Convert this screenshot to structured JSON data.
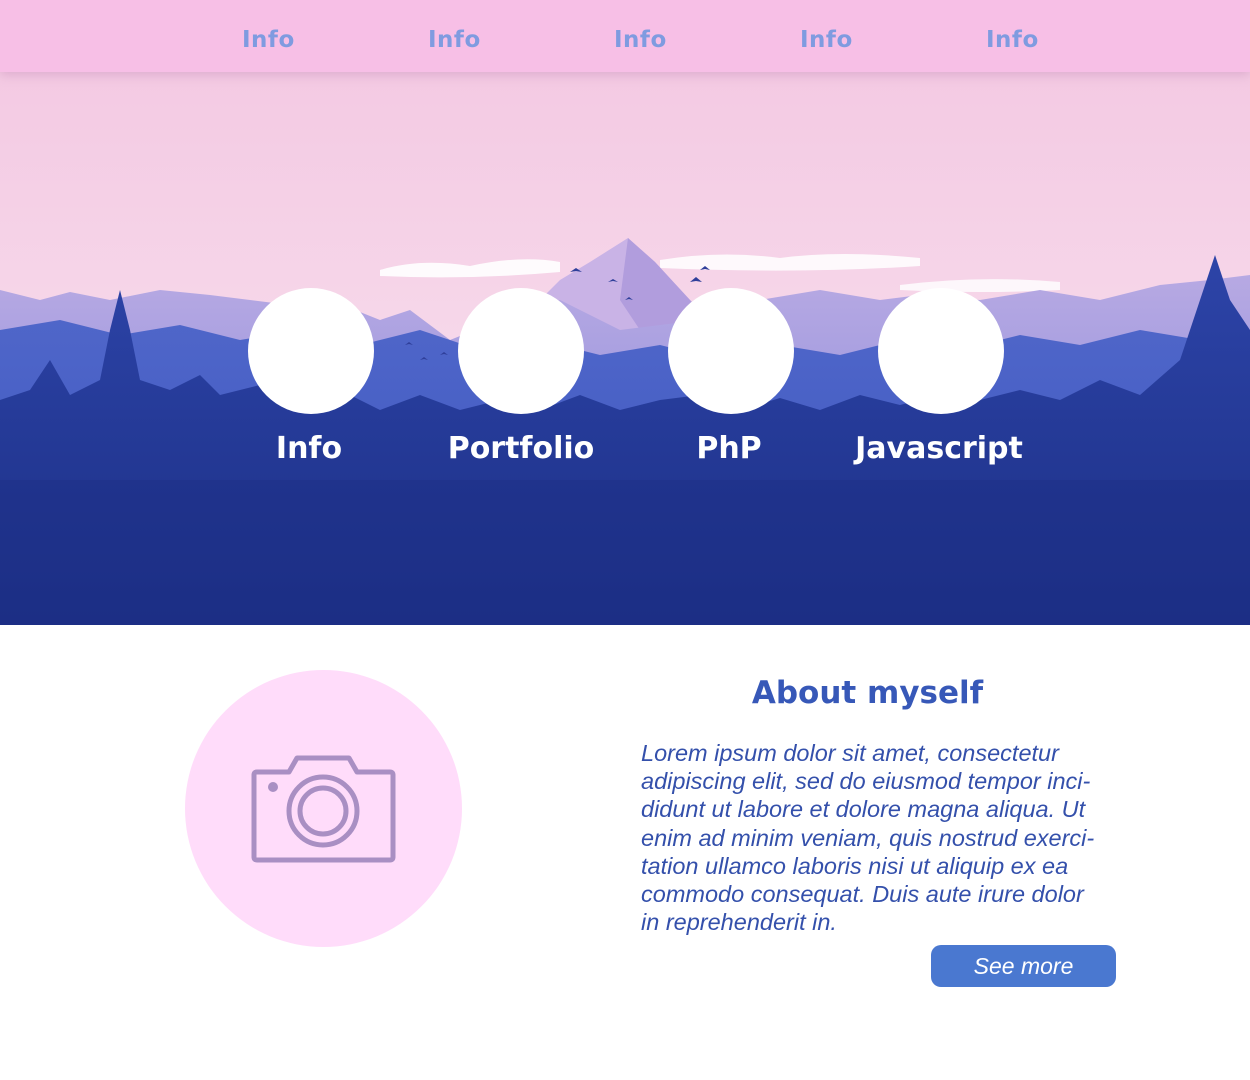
{
  "nav": {
    "items": [
      {
        "label": "Info"
      },
      {
        "label": "Info"
      },
      {
        "label": "Info"
      },
      {
        "label": "Info"
      },
      {
        "label": "Info"
      }
    ]
  },
  "hero": {
    "links": [
      {
        "label": "Info"
      },
      {
        "label": "Portfolio"
      },
      {
        "label": "PhP"
      },
      {
        "label": "Javascript"
      }
    ]
  },
  "about": {
    "photo_icon": "camera-icon",
    "title": "About myself",
    "body": "Lorem ipsum dolor sit amet, consectetur\nadipiscing elit, sed do eiusmod tempor inci-\ndidunt ut labore et dolore magna aliqua. Ut\nenim ad minim veniam, quis nostrud exerci-\ntation ullamco laboris nisi ut aliquip ex ea\ncommodo consequat. Duis aute irure dolor\nin reprehenderit in.",
    "button_label": "See more"
  },
  "colors": {
    "nav_bg": "#f7bfe6",
    "nav_text": "#7f9be0",
    "accent": "#3758b8",
    "button": "#4a78d0",
    "photo_bg": "#ffdcfa",
    "icon": "#a98fc3"
  }
}
